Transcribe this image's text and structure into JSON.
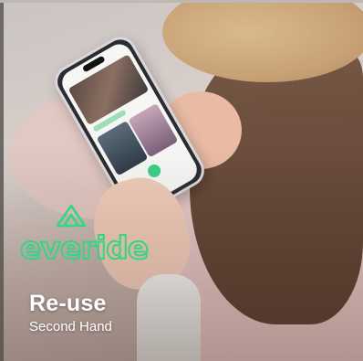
{
  "brand": {
    "name": "everide",
    "accent_color": "#33d684",
    "logo_icon": "mountain-triangle-icon"
  },
  "card": {
    "title": "Re-use",
    "subtitle": "Second Hand"
  },
  "background": {
    "photo": "person-holding-phone-photo"
  }
}
